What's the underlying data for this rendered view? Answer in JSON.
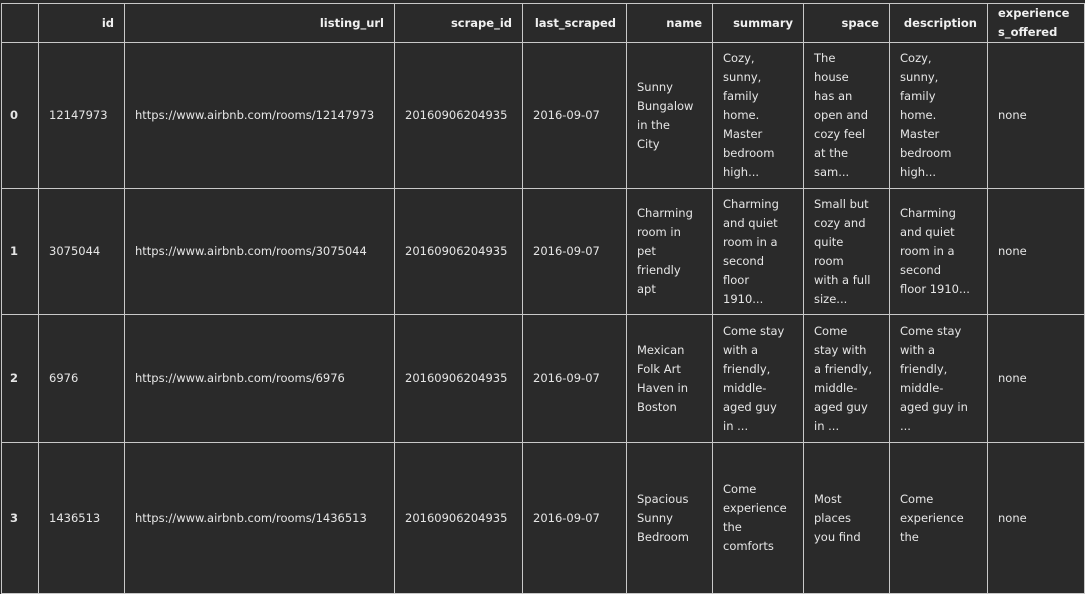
{
  "columns": [
    "",
    "id",
    "listing_url",
    "scrape_id",
    "last_scraped",
    "name",
    "summary",
    "space",
    "description",
    "experiences_offered"
  ],
  "rows": [
    {
      "index": "0",
      "id": "12147973",
      "listing_url": "https://www.airbnb.com/rooms/12147973",
      "scrape_id": "20160906204935",
      "last_scraped": "2016-09-07",
      "name": "Sunny\nBungalow\nin the\nCity",
      "summary": "Cozy,\nsunny,\nfamily\nhome.\nMaster\nbedroom\nhigh...",
      "space": "The\nhouse\nhas an\nopen and\ncozy feel\nat the\nsam...",
      "description": "Cozy,\nsunny,\nfamily\nhome.\nMaster\nbedroom\nhigh...",
      "experiences_offered": "none"
    },
    {
      "index": "1",
      "id": "3075044",
      "listing_url": "https://www.airbnb.com/rooms/3075044",
      "scrape_id": "20160906204935",
      "last_scraped": "2016-09-07",
      "name": "Charming\nroom in\npet\nfriendly\napt",
      "summary": "Charming\nand quiet\nroom in a\nsecond\nfloor\n1910...",
      "space": "Small but\ncozy and\nquite\nroom\nwith a full\nsize...",
      "description": "Charming\nand quiet\nroom in a\nsecond\nfloor 1910...",
      "experiences_offered": "none"
    },
    {
      "index": "2",
      "id": "6976",
      "listing_url": "https://www.airbnb.com/rooms/6976",
      "scrape_id": "20160906204935",
      "last_scraped": "2016-09-07",
      "name": "Mexican\nFolk Art\nHaven in\nBoston",
      "summary": "Come stay\nwith a\nfriendly,\nmiddle-\naged guy\nin ...",
      "space": "Come\nstay with\na friendly,\nmiddle-\naged guy\nin ...",
      "description": "Come stay\nwith a\nfriendly,\nmiddle-\naged guy in\n...",
      "experiences_offered": "none"
    },
    {
      "index": "3",
      "id": "1436513",
      "listing_url": "https://www.airbnb.com/rooms/1436513",
      "scrape_id": "20160906204935",
      "last_scraped": "2016-09-07",
      "name": "Spacious\nSunny\nBedroom",
      "summary": "Come\nexperience\nthe\ncomforts",
      "space": "Most\nplaces\nyou find",
      "description": "Come\nexperience\nthe",
      "experiences_offered": "none"
    }
  ]
}
